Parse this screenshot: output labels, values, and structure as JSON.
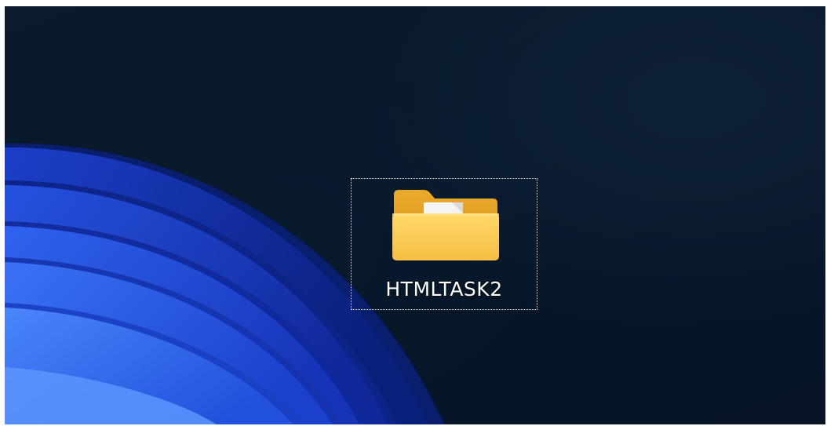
{
  "desktop": {
    "icons": [
      {
        "label": "HTMLTASK2",
        "icon": "folder-icon",
        "selected": true
      }
    ]
  },
  "colors": {
    "wallpaper_dark": "#07182b",
    "bloom_blue": "#1f4fd8",
    "folder_yellow": "#f7c64a",
    "selection_outline": "#e8e8e8"
  }
}
